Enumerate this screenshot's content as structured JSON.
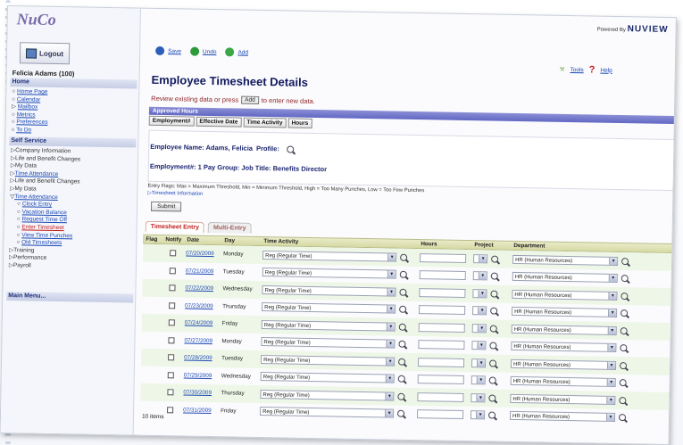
{
  "app": {
    "logo_text": "NuCo",
    "logout_label": "Logout",
    "user_name": "Felicia Adams (100)",
    "powered_by": "Powered By",
    "powered_brand": "NUVIEW"
  },
  "sidebar": {
    "home_header": "Home",
    "home_links": [
      "Home Page",
      "Calendar",
      "Mailbox",
      "Metrics",
      "Preferences",
      "To Do"
    ],
    "self_service_header": "Self Service",
    "self_service_items": [
      "Company Information",
      "Life and Benefit Changes",
      "My Data",
      "Time Attendance",
      "Life and Benefit Changes",
      "My Data"
    ],
    "time_attendance_label": "Time Attendance",
    "time_attendance_links": [
      "Clock Entry",
      "Vacation Balance",
      "Request Time Off",
      "Enter Timesheet",
      "View Time Punches",
      "Old Timesheets"
    ],
    "after_items": [
      "Training",
      "Performance",
      "Payroll"
    ],
    "main_menu": "Main Menu..."
  },
  "toolbar": {
    "save": "Save",
    "undo": "Undo",
    "add": "Add",
    "tools": "Tools",
    "help": "Help"
  },
  "page": {
    "title": "Employee Timesheet Details",
    "instruction_pre": "Review existing data or press",
    "add_button": "Add",
    "instruction_post": "to enter new data.",
    "approved_bar": "Approved Hours",
    "subtabs": [
      "Employment#",
      "Effective Date",
      "Time Activity",
      "Hours"
    ],
    "employee_name_label": "Employee Name: Adams, Felicia",
    "profile_label": "Profile:",
    "employment_row": "Employment#: 1 Pay Group: Job Title: Benefits Director",
    "entry_flags": "Entry Flags: Max = Maximum Threshold, Min = Minimum Threshold, High = Too Many Punches, Low = Too Few Punches",
    "timesheet_info": "Timesheet Information",
    "submit": "Submit",
    "tab_timesheet": "Timesheet Entry",
    "tab_multi": "Multi-Entry",
    "items_count": "10 items"
  },
  "grid": {
    "columns": [
      "Flag",
      "Notify",
      "Date",
      "Day",
      "Time Activity",
      "Hours",
      "Project",
      "Department"
    ],
    "rows": [
      {
        "date": "07/20/2009",
        "day": "Monday",
        "activity": "Reg (Regular Time)",
        "dept": "HR (Human Resources)"
      },
      {
        "date": "07/21/2009",
        "day": "Tuesday",
        "activity": "Reg (Regular Time)",
        "dept": "HR (Human Resources)"
      },
      {
        "date": "07/22/2009",
        "day": "Wednesday",
        "activity": "Reg (Regular Time)",
        "dept": "HR (Human Resources)"
      },
      {
        "date": "07/23/2009",
        "day": "Thursday",
        "activity": "Reg (Regular Time)",
        "dept": "HR (Human Resources)"
      },
      {
        "date": "07/24/2009",
        "day": "Friday",
        "activity": "Reg (Regular Time)",
        "dept": "HR (Human Resources)"
      },
      {
        "date": "07/27/2009",
        "day": "Monday",
        "activity": "Reg (Regular Time)",
        "dept": "HR (Human Resources)"
      },
      {
        "date": "07/28/2009",
        "day": "Tuesday",
        "activity": "Reg (Regular Time)",
        "dept": "HR (Human Resources)"
      },
      {
        "date": "07/29/2009",
        "day": "Wednesday",
        "activity": "Reg (Regular Time)",
        "dept": "HR (Human Resources)"
      },
      {
        "date": "07/30/2009",
        "day": "Thursday",
        "activity": "Reg (Regular Time)",
        "dept": "HR (Human Resources)"
      },
      {
        "date": "07/31/2009",
        "day": "Friday",
        "activity": "Reg (Regular Time)",
        "dept": "HR (Human Resources)"
      }
    ]
  },
  "colors": {
    "title": "#10195e",
    "link": "#1b48b5",
    "approved_bar": "#6268c3",
    "row_alt": "#eef7e7"
  }
}
